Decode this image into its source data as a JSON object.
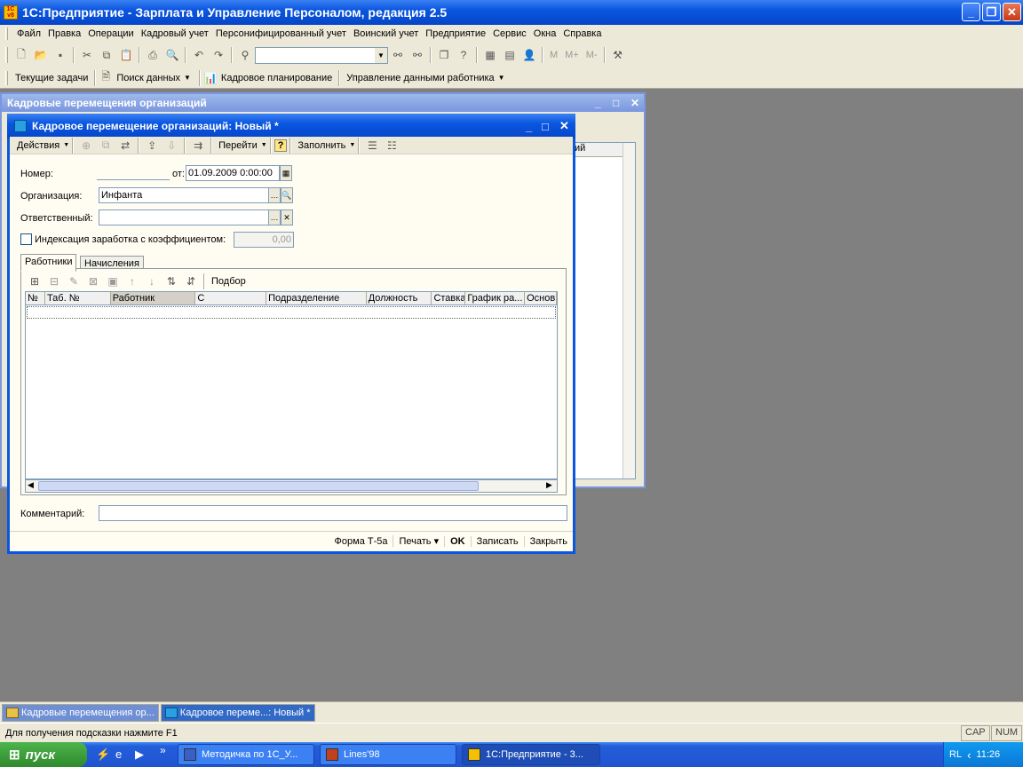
{
  "app": {
    "title": "1С:Предприятие - Зарплата и Управление Персоналом, редакция 2.5",
    "icon_text": "1C\nv8"
  },
  "menu": [
    "Файл",
    "Правка",
    "Операции",
    "Кадровый учет",
    "Персонифицированный учет",
    "Воинский учет",
    "Предприятие",
    "Сервис",
    "Окна",
    "Справка"
  ],
  "toolbar2": {
    "tasks": "Текущие задачи",
    "search": "Поиск данных",
    "planning": "Кадровое планирование",
    "employee_data": "Управление данными работника"
  },
  "toolbar1": {
    "m": "M",
    "mplus": "M+",
    "mminus": "M-"
  },
  "bg_window": {
    "title": "Кадровые перемещения организаций",
    "partial_column": "ий"
  },
  "dialog": {
    "title": "Кадровое перемещение организаций: Новый *",
    "actions": "Действия",
    "goto": "Перейти",
    "fill": "Заполнить",
    "help": "?",
    "number_label": "Номер:",
    "number_value": "",
    "date_label": "от:",
    "date_value": "01.09.2009  0:00:00",
    "org_label": "Организация:",
    "org_value": "Инфанта",
    "resp_label": "Ответственный:",
    "resp_value": "",
    "index_label": "Индексация заработка с коэффициентом:",
    "index_value": "0,00",
    "tabs": [
      "Работники",
      "Начисления"
    ],
    "pick": "Подбор",
    "columns": [
      "№",
      "Таб. №",
      "Работник",
      "С",
      "Подразделение",
      "Должность",
      "Ставка",
      "График ра...",
      "Основ"
    ],
    "comment_label": "Комментарий:",
    "comment_value": "",
    "buttons": {
      "form": "Форма Т-5а",
      "print": "Печать",
      "ok": "OK",
      "save": "Записать",
      "close": "Закрыть"
    }
  },
  "window_tabs": [
    "Кадровые перемещения ор...",
    "Кадровое переме...: Новый *"
  ],
  "status": {
    "hint": "Для получения подсказки нажмите F1",
    "cap": "CAP",
    "num": "NUM"
  },
  "taskbar": {
    "start": "пуск",
    "more": "»",
    "tasks": [
      "Методичка по 1С_У...",
      "Lines'98",
      "1С:Предприятие - 3..."
    ],
    "lang": "RL",
    "time": "11:26"
  }
}
